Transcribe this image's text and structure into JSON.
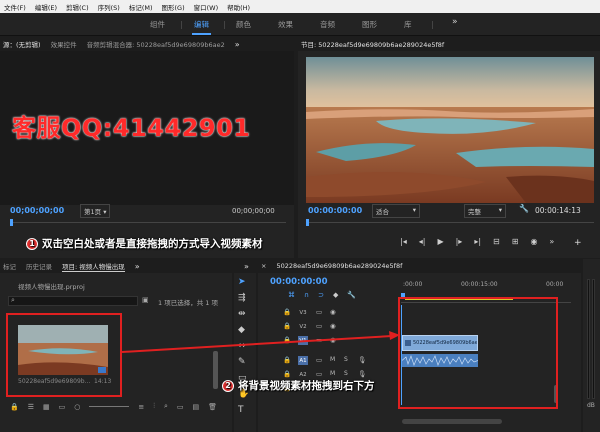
{
  "menu": [
    "文件(F)",
    "编辑(E)",
    "剪辑(C)",
    "序列(S)",
    "标记(M)",
    "图形(G)",
    "窗口(W)",
    "帮助(H)"
  ],
  "workspace_tabs": [
    "组件",
    "编辑",
    "颜色",
    "效果",
    "音频",
    "图形",
    "库"
  ],
  "workspace_more": "»",
  "source_panel": {
    "tabs": [
      "源：(无剪辑)",
      "效果控件",
      "音频剪辑混合器: 50228eaf5d9e69809b6ae2",
      "»"
    ],
    "timecode_left": "00;00;00;00",
    "page": "第1页",
    "timecode_right": "00;00;00;00"
  },
  "watermark": "客服QQ:41442901",
  "program_panel": {
    "title": "节目: 50228eaf5d9e69809b6ae289024e5f8f",
    "timecode": "00:00:00:00",
    "fit": "适合",
    "quality": "完整",
    "duration": "00:00:14:13"
  },
  "annotation1": {
    "num": "1",
    "text": "双击空白处或者是直接拖拽的方式导入视频素材"
  },
  "annotation2": {
    "num": "2",
    "text": "将背景视频素材拖拽到右下方"
  },
  "project_panel": {
    "tabs": [
      "标记",
      "历史记录",
      "项目: 视频人物慢出现",
      "»"
    ],
    "file": "视频人物慢出现.prproj",
    "status": "1 项已选择，共 1 项",
    "clip_name": "50228eaf5d9e69809b...",
    "clip_duration": "14:13"
  },
  "timeline": {
    "tab": "50228eaf5d9e69809b6ae289024e5f8f",
    "timecode": "00:00:00:00",
    "ruler_start": ":00:00",
    "ruler_mid": "00:00:15:00",
    "ruler_end": "00:00",
    "video_tracks": [
      "V3",
      "V2",
      "V1"
    ],
    "audio_tracks": [
      "A1",
      "A2",
      "A3"
    ],
    "track_letters": [
      "M",
      "S"
    ],
    "clip_label": "50228eaf5d9e69809b6ae289024e5f8f.mp4",
    "meter_db": "dB"
  },
  "colors": {
    "accent": "#4ea2ff",
    "annotation_red": "#e02020",
    "clip_blue": "#7fa9d9"
  }
}
